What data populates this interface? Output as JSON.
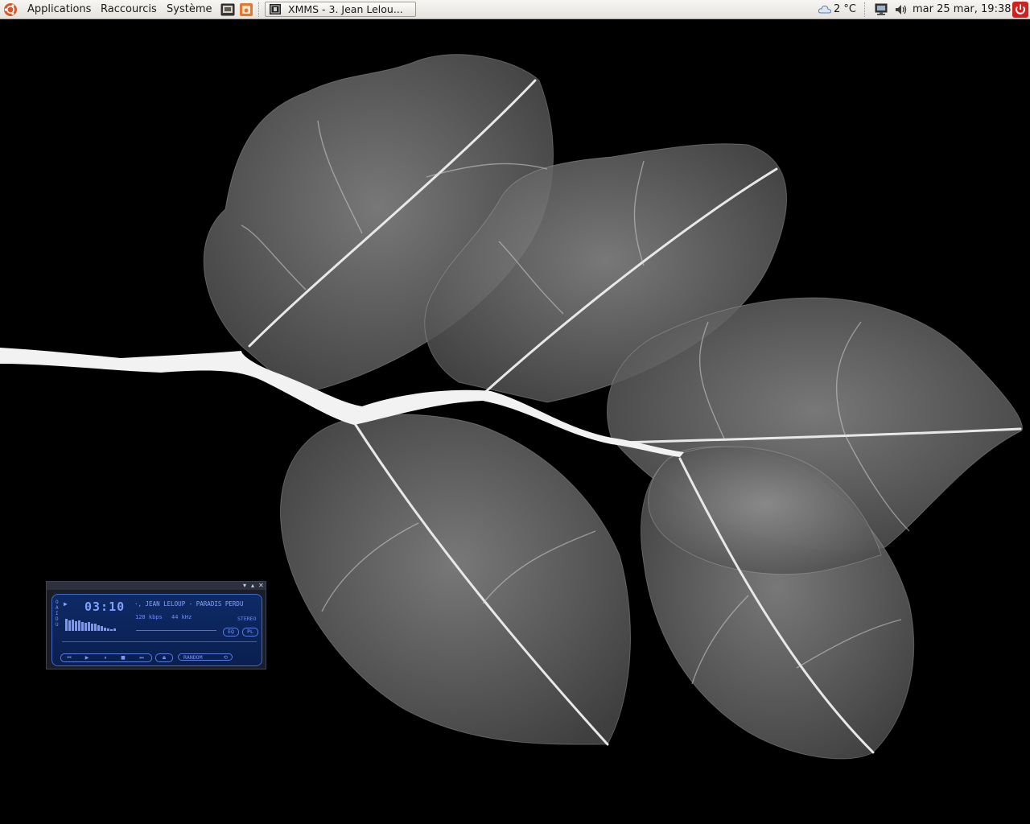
{
  "panel": {
    "menus": [
      "Applications",
      "Raccourcis",
      "Système"
    ],
    "task": {
      "label": "XMMS - 3. Jean Lelou..."
    },
    "weather": "2 °C",
    "clock": "mar 25 mar, 19:38"
  },
  "xmms": {
    "clutterbar": "O A I D U",
    "time": "03:10",
    "song": "3. JEAN LELOUP - PARADIS PERDU",
    "song_visible": "·, JEAN LELOUP - PARADIS PERDU",
    "bitrate": "128 kbps",
    "samplerate": "44 kHz",
    "mode": "STEREO",
    "eq_label": "EQ",
    "pl_label": "PL",
    "random_label": "RANDOM",
    "spectrum": [
      0.85,
      0.7,
      0.78,
      0.65,
      0.72,
      0.6,
      0.55,
      0.62,
      0.5,
      0.48,
      0.4,
      0.35,
      0.2,
      0.15,
      0.1,
      0.18
    ]
  },
  "icons": {
    "ubuntu": "ubuntu-logo-icon",
    "terminal": "terminal-launcher-icon",
    "firefox": "browser-launcher-icon",
    "weather": "cloud-icon",
    "network": "network-icon",
    "volume": "speaker-icon",
    "power": "power-icon"
  }
}
